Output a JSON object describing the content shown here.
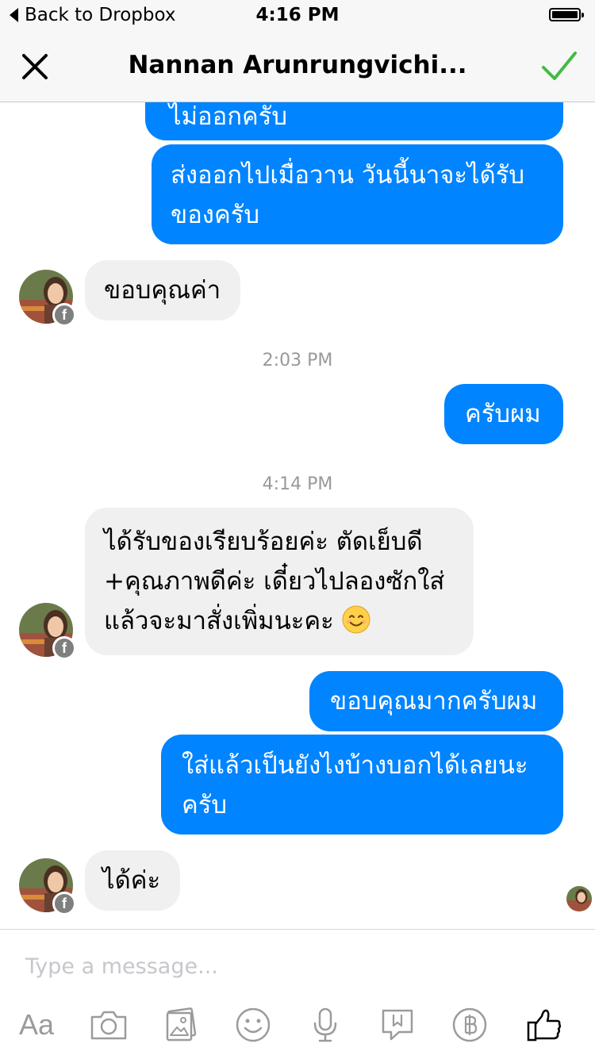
{
  "status_bar": {
    "back_label": "Back to Dropbox",
    "time": "4:16 PM"
  },
  "nav": {
    "title": "Nannan Arunrungvichi..."
  },
  "messages": [
    {
      "dir": "out",
      "text": "ไม่ออกครับ"
    },
    {
      "dir": "out",
      "text": "ส่งออกไปเมื่อวาน วันนี้นาจะได้รับ ของครับ"
    },
    {
      "dir": "in",
      "text": "ขอบคุณค่า"
    },
    {
      "time": "2:03 PM"
    },
    {
      "dir": "out",
      "text": "ครับผม"
    },
    {
      "time": "4:14 PM"
    },
    {
      "dir": "in",
      "text": "ได้รับของเรียบร้อยค่ะ ตัดเย็บดี +คุณภาพดีค่ะ เดี๋ยวไปลองซักใส่ แล้วจะมาสั่งเพิ่มนะคะ",
      "emoji": "smiling-face"
    },
    {
      "dir": "out",
      "text": "ขอบคุณมากครับผม"
    },
    {
      "dir": "out",
      "text": "ใส่แล้วเป็นยังไงบ้างบอกได้เลยนะ ครับ"
    },
    {
      "dir": "in",
      "text": "ได้ค่ะ"
    }
  ],
  "composer": {
    "placeholder": "Type a message...",
    "tools": [
      {
        "label": "Aa"
      },
      {
        "icon": "camera-icon"
      },
      {
        "icon": "gallery-icon"
      },
      {
        "icon": "emoji-icon"
      },
      {
        "icon": "microphone-icon"
      },
      {
        "icon": "sticker-icon"
      },
      {
        "icon": "payment-baht-icon"
      },
      {
        "icon": "like-icon"
      }
    ]
  },
  "colors": {
    "outgoing_bubble": "#0084ff",
    "incoming_bubble": "#f0f0f0",
    "done_check": "#44bb44",
    "timestamp": "#999999"
  }
}
